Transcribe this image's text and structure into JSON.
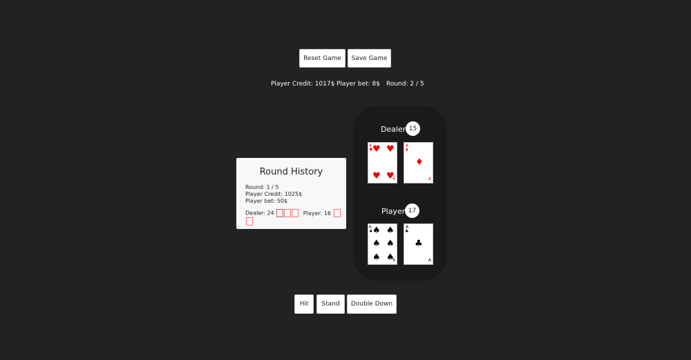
{
  "controls": {
    "reset_label": "Reset Game",
    "save_label": "Save Game"
  },
  "stats": {
    "credit": "Player Credit: 1017$",
    "bet": "Player bet: 8$",
    "round": "Round: 2 / 5"
  },
  "dealer": {
    "label": "Dealer",
    "score": "15",
    "cards": [
      {
        "rank": "4",
        "suit": "♥",
        "color": "#e00000"
      },
      {
        "rank": "A",
        "suit": "♦",
        "color": "#e00000"
      }
    ]
  },
  "player": {
    "label": "Player",
    "score": "17",
    "cards": [
      {
        "rank": "6",
        "suit": "♠",
        "color": "#000000"
      },
      {
        "rank": "A",
        "suit": "♣",
        "color": "#000000"
      }
    ]
  },
  "history": {
    "title": "Round History",
    "round": "Round: 1 / 5",
    "credit": "Player Credit: 1025$",
    "bet": "Player bet: 50$",
    "dealer": "Dealer: 24",
    "player": "Player: 16"
  },
  "actions": {
    "hit": "Hit",
    "stand": "Stand",
    "double_down": "Double Down"
  },
  "colors": {
    "background": "#222224",
    "table": "#1a1a1b",
    "red_suit": "#e00000",
    "black_suit": "#000000"
  }
}
